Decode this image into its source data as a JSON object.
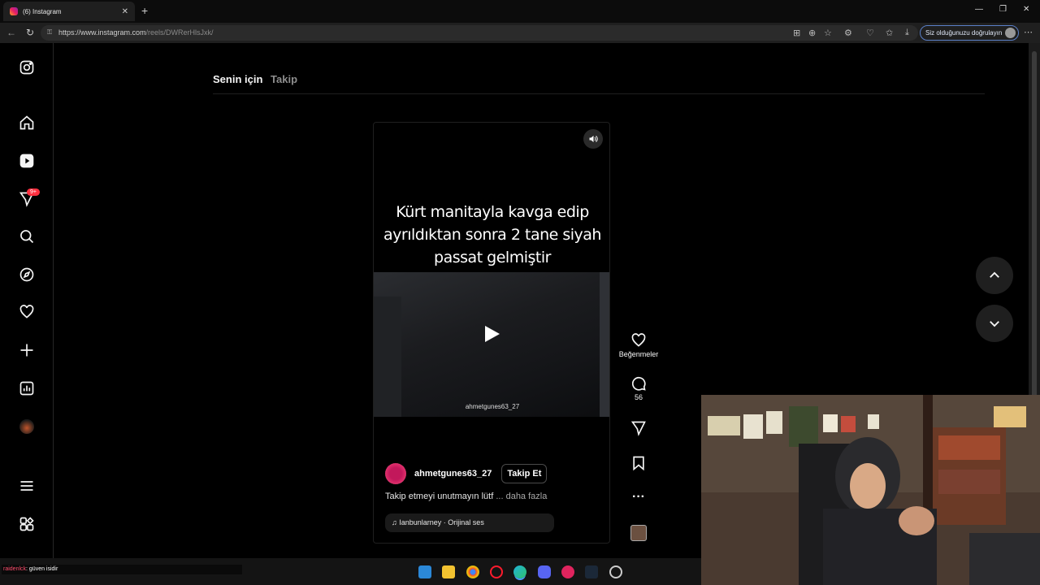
{
  "browser": {
    "tab_title": "(6) Instagram",
    "url_host": "https://www.instagram.com",
    "url_path": "/reels/DWRerHlsJxk/",
    "profile_pill": "Siz olduğunuzu doğrulayın"
  },
  "feed": {
    "tabs": [
      "Senin için",
      "Takip"
    ]
  },
  "sidebar": {
    "notification_badge": "9+"
  },
  "reel": {
    "overlay_text_lines": [
      "Kürt manitayla kavga edip",
      "ayrıldıktan sonra 2 tane siyah",
      "passat gelmiştir"
    ],
    "watermark": "ahmetgunes63_27",
    "author": "ahmetgunes63_27",
    "follow_label": "Takip Et",
    "description": "Takip etmeyi unutmayın lütf",
    "more_label": "... daha fazla",
    "audio": "Ianbunlarney · Orijinal ses"
  },
  "actions": {
    "likes_label": "Beğenmeler",
    "comments_count": "56"
  },
  "taskbar": {
    "chat_user": "raidenlck",
    "chat_message": ": güven isidir"
  },
  "colors": {
    "background": "#000000",
    "badge": "#ff3040",
    "accent_border": "#5a7fc7"
  }
}
